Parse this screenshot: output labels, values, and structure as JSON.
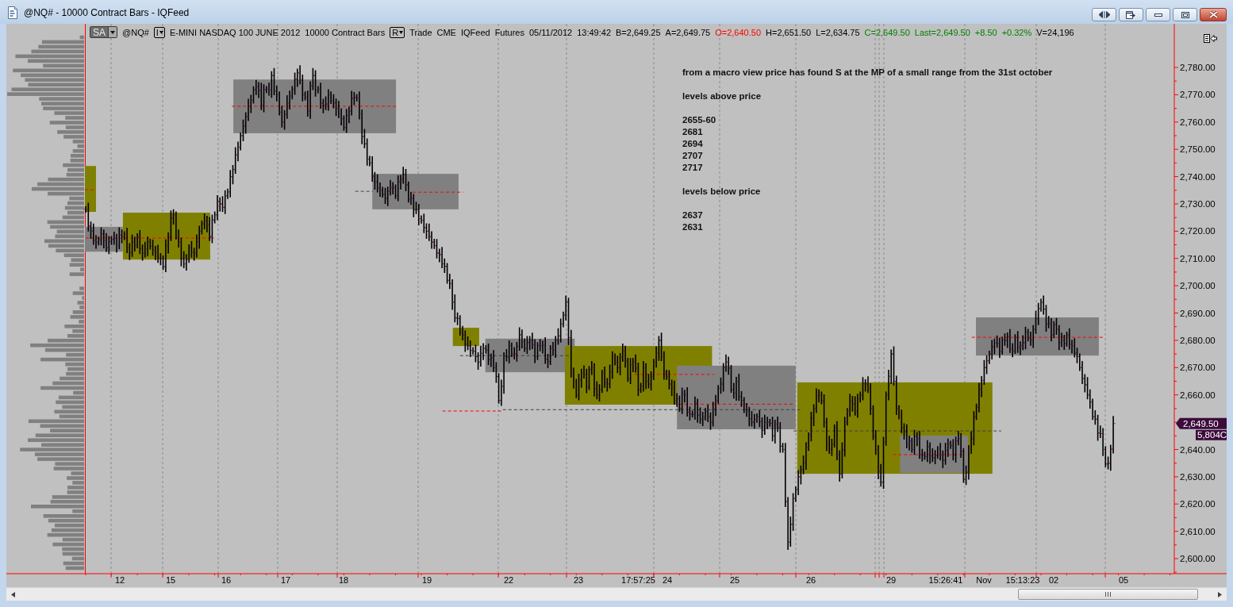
{
  "window": {
    "title": "@NQ# - 10000 Contract Bars - IQFeed"
  },
  "chart": {
    "header": {
      "menu_button": "SA",
      "symbol": "@NQ#",
      "interval_button": "I",
      "description": "E-MINI NASDAQ 100 JUNE 2012",
      "bar_type": "10000 Contract Bars",
      "range_button": "R",
      "quote_fields": [
        {
          "text": "Trade",
          "color": "#000000"
        },
        {
          "text": "CME",
          "color": "#000000"
        },
        {
          "text": "IQFeed",
          "color": "#000000"
        },
        {
          "text": "Futures",
          "color": "#000000"
        },
        {
          "text": "05/11/2012",
          "color": "#000000"
        },
        {
          "text": "13:49:42",
          "color": "#000000"
        },
        {
          "text": "B=2,649.25",
          "color": "#000000"
        },
        {
          "text": "A=2,649.75",
          "color": "#000000"
        },
        {
          "text": "O=2,640.50",
          "color": "#ff0000"
        },
        {
          "text": "H=2,651.50",
          "color": "#000000"
        },
        {
          "text": "L=2,634.75",
          "color": "#000000"
        },
        {
          "text": "C=2,649.50",
          "color": "#008000"
        },
        {
          "text": "Last=2,649.50",
          "color": "#008000"
        },
        {
          "text": "+8.50",
          "color": "#008000"
        },
        {
          "text": "+0.32%",
          "color": "#008000"
        },
        {
          "text": "V=24,196",
          "color": "#000000"
        }
      ]
    },
    "note": {
      "headline": "from a macro view price has found S at the MP of a small range from the 31st october",
      "sections": [
        {
          "heading": "levels above price",
          "levels": [
            "2655-60",
            "2681",
            "2694",
            "2707",
            "2717"
          ]
        },
        {
          "heading": "levels below price",
          "levels": [
            "2637",
            "2631"
          ]
        }
      ]
    },
    "price_axis": {
      "items": [
        {
          "kind": "label",
          "text": "2,780.00"
        },
        {
          "kind": "label",
          "text": "2,770.00"
        },
        {
          "kind": "label",
          "text": "2,760.00"
        },
        {
          "kind": "label",
          "text": "2,750.00"
        },
        {
          "kind": "label",
          "text": "2,740.00"
        },
        {
          "kind": "label",
          "text": "2,730.00"
        },
        {
          "kind": "label",
          "text": "2,720.00"
        },
        {
          "kind": "label",
          "text": "2,710.00"
        },
        {
          "kind": "label",
          "text": "2,700.00"
        },
        {
          "kind": "label",
          "text": "2,690.00"
        },
        {
          "kind": "label",
          "text": "2,680.00"
        },
        {
          "kind": "label",
          "text": "2,670.00"
        },
        {
          "kind": "label",
          "text": "2,660.00"
        },
        {
          "kind": "price-tag",
          "text": "2,649.50",
          "volume": "5,804C"
        },
        {
          "kind": "label",
          "text": "2,640.00"
        },
        {
          "kind": "label",
          "text": "2,630.00"
        },
        {
          "kind": "label",
          "text": "2,620.00"
        },
        {
          "kind": "label",
          "text": "2,610.00"
        },
        {
          "kind": "label",
          "text": "2,600.00"
        }
      ]
    },
    "time_axis": {
      "labels": [
        "12",
        "15",
        "16",
        "17",
        "18",
        "19",
        "22",
        "23",
        "17:57:25",
        "24",
        "25",
        "26",
        "29",
        "15:26:41",
        "Nov",
        "15:13:23",
        "02",
        "05"
      ]
    }
  }
}
